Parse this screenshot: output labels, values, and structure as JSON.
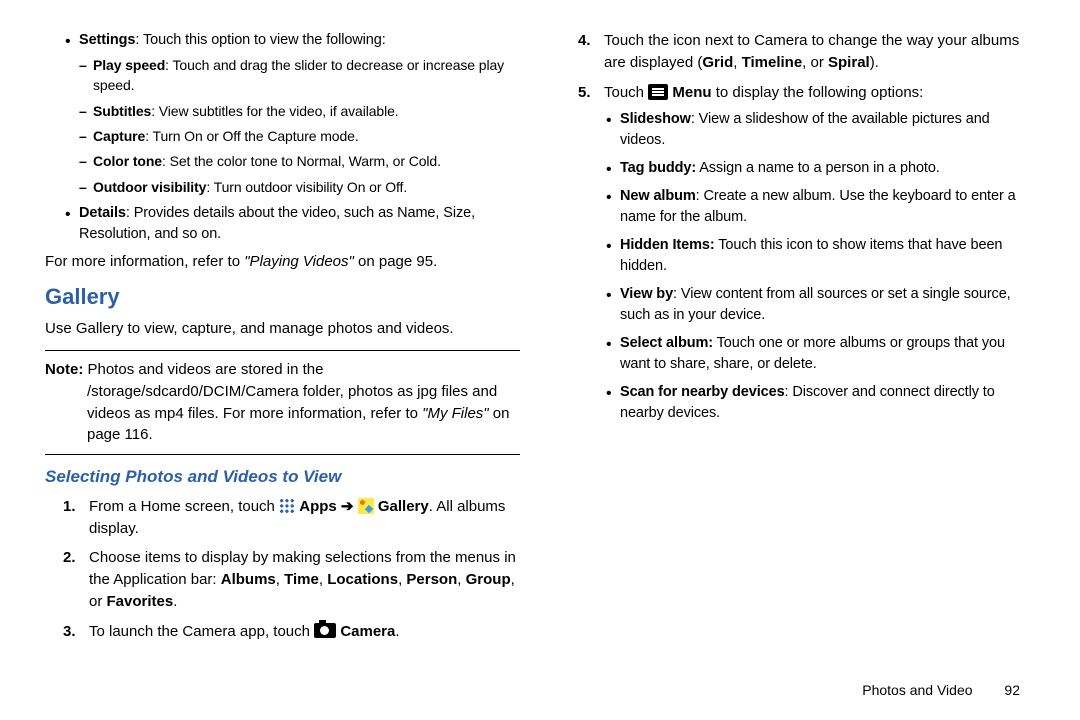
{
  "leftColumn": {
    "settings": {
      "label": "Settings",
      "desc": ": Touch this option to view the following:",
      "items": [
        {
          "label": "Play speed",
          "desc": ": Touch and drag the slider to decrease or increase play speed."
        },
        {
          "label": "Subtitles",
          "desc": ": View subtitles for the video, if available."
        },
        {
          "label": "Capture",
          "desc": ": Turn On or Off the Capture mode."
        },
        {
          "label": "Color tone",
          "desc": ": Set the color tone to Normal, Warm, or Cold."
        },
        {
          "label": "Outdoor visibility",
          "desc": ": Turn outdoor visibility On or Off."
        }
      ]
    },
    "details": {
      "label": "Details",
      "desc": ": Provides details about the video, such as Name, Size, Resolution, and so on."
    },
    "moreInfo1a": "For more information, refer to ",
    "moreInfo1ref": "\"Playing Videos\"",
    "moreInfo1b": " on page 95.",
    "galleryHeading": "Gallery",
    "galleryIntro": "Use Gallery to view, capture, and manage photos and videos.",
    "noteLabel": "Note:",
    "noteBody1": " Photos and videos are stored in the /storage/sdcard0/DCIM/Camera folder, photos as jpg files and videos as mp4 files. For more information, refer to ",
    "noteRef": "\"My Files\"",
    "noteBody2": " on page 116.",
    "subHeading": "Selecting Photos and Videos to View",
    "step1a": "From a Home screen, touch ",
    "apps": " Apps",
    "arrow": " ➔ ",
    "gallery": " Gallery",
    "step1b": ". All albums display."
  },
  "rightColumn": {
    "step2a": "Choose items to display by making selections from the menus in the Application bar: ",
    "step2labels": [
      "Albums",
      "Time",
      "Locations",
      "Person",
      "Group",
      "Favorites"
    ],
    "step3a": "To launch the Camera app, touch ",
    "cameraLabel": " Camera",
    "step4a": "Touch the icon next to Camera to change the way your albums are displayed (",
    "step4labels": [
      "Grid",
      "Timeline",
      "Spiral"
    ],
    "step4b": ").",
    "step5a": "Touch ",
    "menuLabel": " Menu",
    "step5b": " to display the following options:",
    "menuItems": [
      {
        "label": "Slideshow",
        "desc": ": View a slideshow of the available pictures and videos."
      },
      {
        "label": "Tag buddy:",
        "desc": " Assign a name to a person in a photo."
      },
      {
        "label": "New album",
        "desc": ": Create a new album. Use the keyboard to enter a name for the album."
      },
      {
        "label": "Hidden Items:",
        "desc": "  Touch this icon to show items that have been hidden."
      },
      {
        "label": "View by",
        "desc": ": View content from all sources or set a single source, such as in your device."
      },
      {
        "label": "Select album:",
        "desc": " Touch one or more albums or groups that you want to share, share, or delete."
      },
      {
        "label": "Scan for nearby devices",
        "desc": ": Discover and connect directly to nearby devices."
      }
    ]
  },
  "footer": {
    "section": "Photos and Video",
    "page": "92"
  }
}
